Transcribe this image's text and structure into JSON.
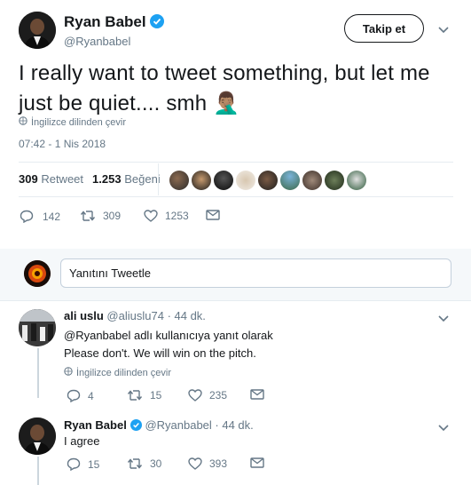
{
  "author": {
    "name": "Ryan Babel",
    "handle": "@Ryanbabel"
  },
  "follow_button": "Takip et",
  "tweet": {
    "text": "I really want to tweet something, but let me just be quiet.... smh 🤦🏽‍♂️",
    "translate": "İngilizce dilinden çevir",
    "timestamp": "07:42 - 1 Nis 2018"
  },
  "stats": {
    "retweets": "309",
    "retweets_label": "Retweet",
    "likes": "1.253",
    "likes_label": "Beğeni"
  },
  "actions": {
    "replies": "142",
    "retweets": "309",
    "likes": "1253"
  },
  "reply_placeholder": "Yanıtını Tweetle",
  "replies": [
    {
      "name": "ali uslu",
      "handle": "@aliuslu74",
      "time": "· 44 dk.",
      "reply_to": "@Ryanbabel adlı kullanıcıya yanıt olarak",
      "text": "Please don't. We will win on the pitch.",
      "translate": "İngilizce dilinden çevir",
      "replies": "4",
      "retweets": "15",
      "likes": "235"
    },
    {
      "name": "Ryan Babel",
      "handle": "@Ryanbabel",
      "time": "· 44 dk.",
      "text": "I agree",
      "replies": "15",
      "retweets": "30",
      "likes": "393"
    }
  ],
  "colors": {
    "text": "#14171a",
    "muted": "#657786",
    "verified": "#1da1f2",
    "border": "#e6ecf0"
  }
}
